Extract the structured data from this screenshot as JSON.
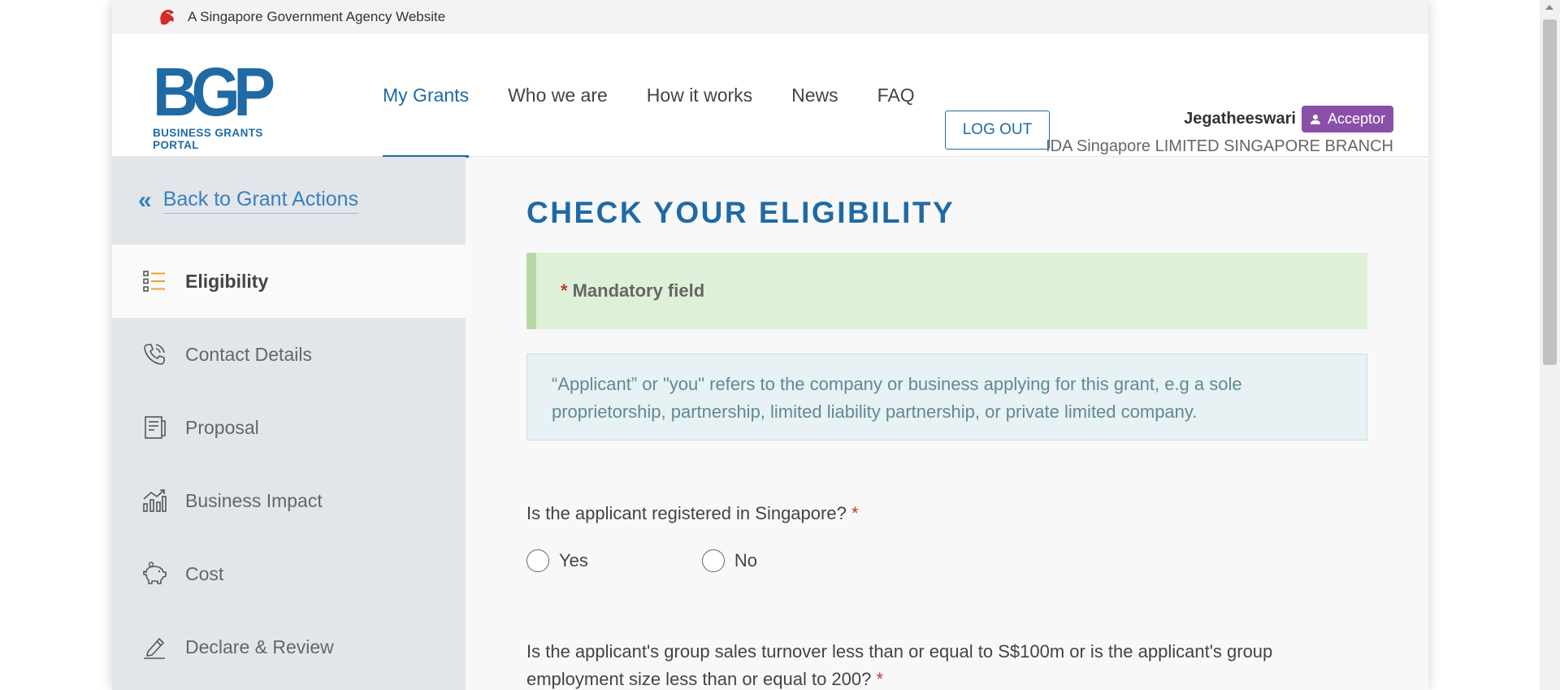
{
  "gov_bar": {
    "text": "A Singapore Government Agency Website",
    "icon": "lion-head-icon"
  },
  "logo": {
    "main": "BGP",
    "sub": "BUSINESS GRANTS PORTAL"
  },
  "nav": {
    "items": [
      "My Grants",
      "Who we are",
      "How it works",
      "News",
      "FAQ"
    ],
    "active": "My Grants"
  },
  "logout": "LOG OUT",
  "user": {
    "name": "Jegatheeswari",
    "role": "Acceptor",
    "org": "IDA Singapore LIMITED SINGAPORE BRANCH"
  },
  "sidebar": {
    "back": "Back to Grant Actions",
    "items": [
      {
        "label": "Eligibility",
        "icon": "checklist-icon",
        "active": true
      },
      {
        "label": "Contact Details",
        "icon": "phone-icon"
      },
      {
        "label": "Proposal",
        "icon": "document-icon"
      },
      {
        "label": "Business Impact",
        "icon": "chart-up-icon"
      },
      {
        "label": "Cost",
        "icon": "piggy-bank-icon"
      },
      {
        "label": "Declare & Review",
        "icon": "pen-icon"
      }
    ]
  },
  "main": {
    "title": "CHECK YOUR ELIGIBILITY",
    "mandatory_star": "*",
    "mandatory_text": "Mandatory field",
    "info": "“Applicant” or \"you\" refers to the company or business applying for this grant, e.g a sole proprietorship, partnership, limited liability partnership, or private limited company.",
    "q1": "Is the applicant registered in Singapore?",
    "q1_options": [
      "Yes",
      "No"
    ],
    "q2": "Is the applicant's group sales turnover less than or equal to S$100m or is the applicant's group employment size less than or equal to 200?",
    "required_star": "*"
  },
  "colors": {
    "brand": "#1f6aa5",
    "role_badge": "#8a4fa8",
    "mandatory_bg": "#dff0d8",
    "info_bg": "#e8f1f3"
  }
}
